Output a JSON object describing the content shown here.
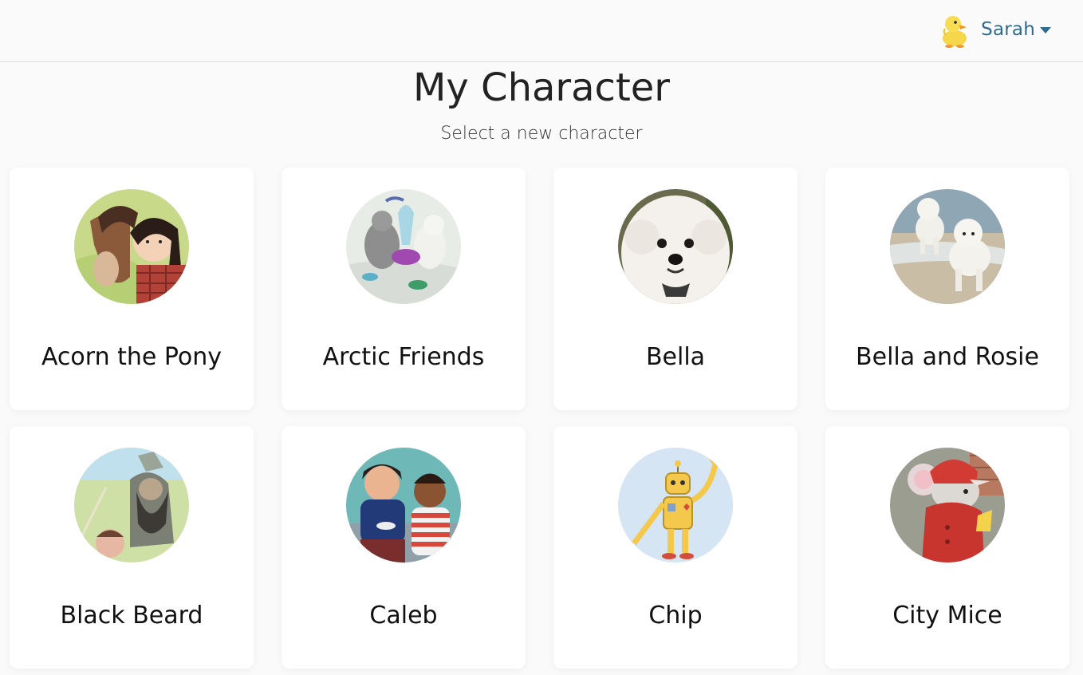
{
  "user": {
    "name": "Sarah",
    "avatar_icon": "duckling-icon"
  },
  "page": {
    "title": "My Character",
    "subtitle": "Select a new character"
  },
  "characters": [
    {
      "name": "Acorn the Pony",
      "image": "pony-and-girl-portrait"
    },
    {
      "name": "Arctic Friends",
      "image": "arctic-animals-portrait"
    },
    {
      "name": "Bella",
      "image": "white-dog-portrait"
    },
    {
      "name": "Bella and Rosie",
      "image": "two-dogs-beach-portrait"
    },
    {
      "name": "Black Beard",
      "image": "pirate-portrait"
    },
    {
      "name": "Caleb",
      "image": "two-kids-portrait"
    },
    {
      "name": "Chip",
      "image": "robot-portrait"
    },
    {
      "name": "City Mice",
      "image": "mouse-portrait"
    }
  ],
  "colors": {
    "accent": "#2f6b8c",
    "background": "#fafafa",
    "card": "#ffffff"
  }
}
